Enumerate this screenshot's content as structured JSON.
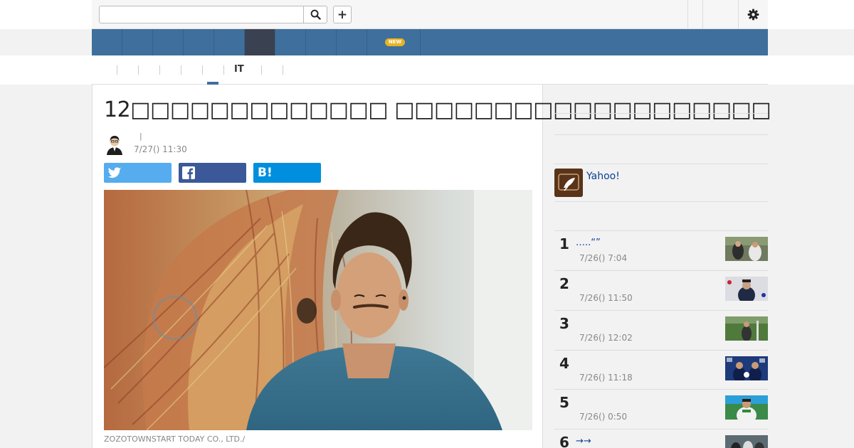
{
  "topbar": {
    "search_placeholder": "",
    "plus_label": "+"
  },
  "navbar": {
    "new_badge": "NEW"
  },
  "subnav": {
    "it_label": "IT"
  },
  "article": {
    "title": "12□□□□□□□□□□□□□ □□□□□□□□□□□□□□□□□□□",
    "byline_separator": "|",
    "timestamp": "7/27() 11:30",
    "share": {
      "twitter_icon": "twitter-bird-icon",
      "facebook_icon": "facebook-f-icon",
      "hatena_label": "B!"
    },
    "photo_caption": "ZOZOTOWNSTART TODAY CO., LTD./"
  },
  "sidebar": {
    "yahoo_label": "Yahoo!",
    "ranking": [
      {
        "rank": "1",
        "title": "…..“”",
        "time": "7/26() 7:04"
      },
      {
        "rank": "2",
        "title": "",
        "time": "7/26() 11:50"
      },
      {
        "rank": "3",
        "title": "",
        "time": "7/26() 12:02"
      },
      {
        "rank": "4",
        "title": "",
        "time": "7/26() 11:18"
      },
      {
        "rank": "5",
        "title": "",
        "time": "7/26() 0:50"
      },
      {
        "rank": "6",
        "title": "→→",
        "time": ""
      }
    ]
  },
  "colors": {
    "nav_blue": "#3f6f9c",
    "nav_active": "#3a4150",
    "twitter": "#55acee",
    "facebook": "#3b5998",
    "hatena": "#008fde",
    "link": "#0b3d91",
    "badge": "#e8b321"
  }
}
